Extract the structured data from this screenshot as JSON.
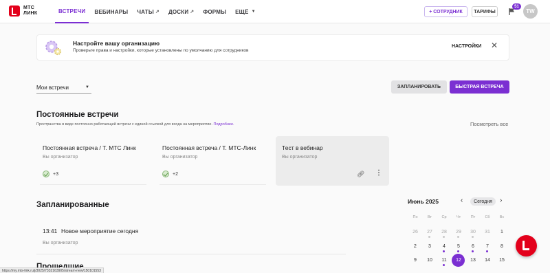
{
  "header": {
    "logo_line1": "МТС",
    "logo_line2": "ЛИНК",
    "nav": [
      {
        "label": "ВСТРЕЧИ",
        "active": true
      },
      {
        "label": "ВЕБИНАРЫ"
      },
      {
        "label": "ЧАТЫ",
        "external": true
      },
      {
        "label": "ДОСКИ",
        "external": true
      },
      {
        "label": "ФОРМЫ"
      },
      {
        "label": "ЕЩЁ",
        "dropdown": true
      }
    ],
    "add_employee": "+ СОТРУДНИК",
    "tariffs": "ТАРИФЫ",
    "notifications_count": "51",
    "avatar_initials": "TW",
    "accent_color": "#7b2fd2",
    "brand_color": "#e3001b"
  },
  "banner": {
    "title": "Настройте вашу организацию",
    "subtitle": "Проверьте права и настройки, которые установлены по умолчанию для сотрудников",
    "settings_label": "НАСТРОЙКИ",
    "close_icon": "close-icon"
  },
  "toolbar": {
    "filter_value": "Мои встречи",
    "schedule_label": "ЗАПЛАНИРОВАТЬ",
    "quick_meeting_label": "БЫСТРАЯ ВСТРЕЧА"
  },
  "permanent": {
    "title": "Постоянные встречи",
    "subtitle": "Пространства в виде постоянно работающей встречи с единой ссылкой для входа на мероприятие.",
    "subtitle_link": "Подробнее.",
    "view_all": "Посмотреть все",
    "cards": [
      {
        "title": "Постоянная встреча / Т. МТС Линк",
        "org": "Вы организатор",
        "participants": "+3"
      },
      {
        "title": "Постоянная встреча / Т. МТС-Линк",
        "org": "Вы организатор",
        "participants": "+2"
      },
      {
        "title": "Тест в вебинар",
        "org": "Вы организатор"
      }
    ]
  },
  "scheduled": {
    "title": "Запланированные",
    "items": [
      {
        "time": "13:41",
        "name": "Новое мероприятие сегодня",
        "org": "Вы организатор"
      }
    ]
  },
  "past": {
    "title": "Прошедшие"
  },
  "calendar": {
    "month": "Июнь 2025",
    "today_label": "Сегодня",
    "weekdays": [
      "Пн",
      "Вт",
      "Ср",
      "Чт",
      "Пт",
      "Сб",
      "Вс"
    ],
    "weeks": [
      [
        "26",
        "27",
        "28",
        "29",
        "30",
        "31",
        "1"
      ],
      [
        "2",
        "3",
        "4",
        "5",
        "6",
        "7",
        "8"
      ],
      [
        "9",
        "10",
        "11",
        "12",
        "13",
        "14",
        "15"
      ]
    ],
    "selected_day": "12"
  },
  "status_url": "https://my.mts-link.ru/j/3025/7332163905/stream-new/150101553"
}
